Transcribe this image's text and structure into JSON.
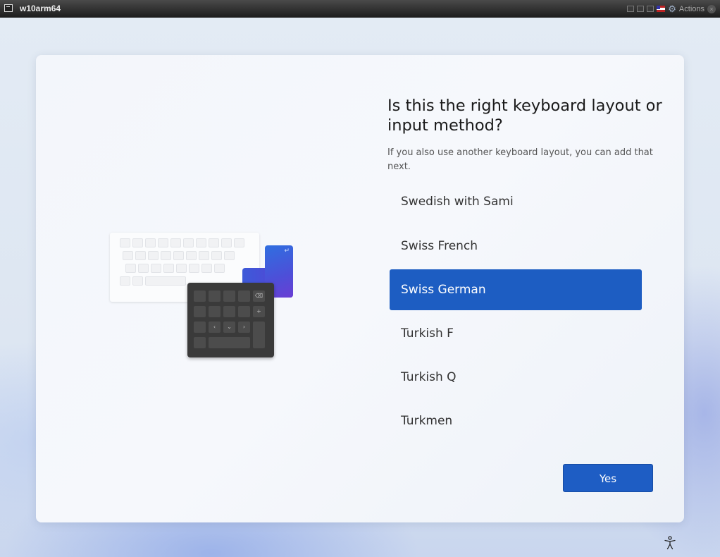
{
  "window": {
    "title": "w10arm64",
    "actions_label": "Actions"
  },
  "setup": {
    "heading": "Is this the right keyboard layout or input method?",
    "subtext": "If you also use another keyboard layout, you can add that next.",
    "layouts": [
      {
        "label": "Swedish with Sami",
        "selected": false
      },
      {
        "label": "Swiss French",
        "selected": false
      },
      {
        "label": "Swiss German",
        "selected": true
      },
      {
        "label": "Turkish F",
        "selected": false
      },
      {
        "label": "Turkish Q",
        "selected": false
      },
      {
        "label": "Turkmen",
        "selected": false
      }
    ],
    "yes_label": "Yes"
  },
  "colors": {
    "accent": "#1d5dc2",
    "titlebar": "#2a2a2a"
  },
  "icons": {
    "accessibility": "accessibility-icon",
    "gear": "gear-icon"
  }
}
